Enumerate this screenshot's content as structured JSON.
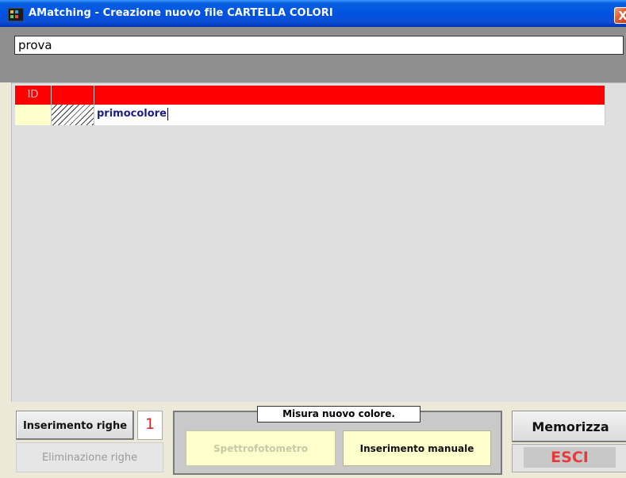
{
  "window": {
    "title": "AMatching - Creazione nuovo file CARTELLA COLORI",
    "close_glyph": "X"
  },
  "file_name": {
    "value": "prova"
  },
  "grid": {
    "headers": [
      "ID",
      "",
      ""
    ],
    "rows": [
      {
        "id": "",
        "swatch": "hatched",
        "name": "primocolore"
      }
    ],
    "header_color": "#ff0000"
  },
  "controls": {
    "ins_righe_label": "Inserimento righe",
    "row_count": "1",
    "elim_righe_label": "Eliminazione righe",
    "misura_label": "Misura nuovo colore.",
    "spettro_label": "Spettrofotometro",
    "manuale_label": "Inserimento manuale",
    "memorizza_label": "Memorizza",
    "esci_label": "ESCI"
  },
  "icons": {
    "app": "amatching-app-icon",
    "close": "close-icon"
  }
}
